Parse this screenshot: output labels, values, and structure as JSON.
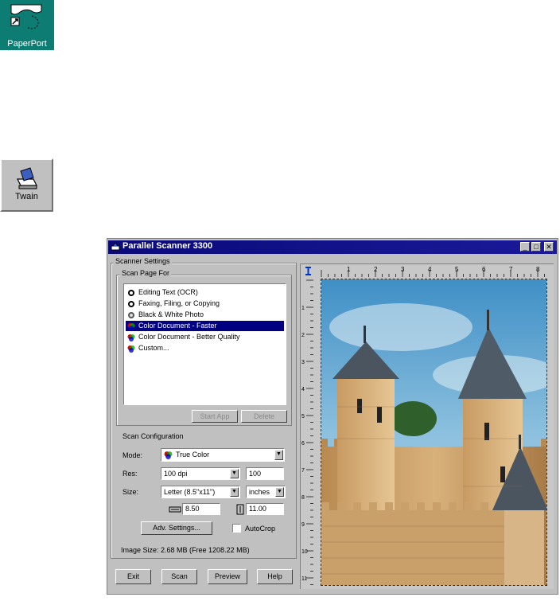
{
  "desktop": {
    "paperport_label": "PaperPort",
    "twain_label": "Twain"
  },
  "dialog": {
    "title": "Parallel Scanner 3300",
    "minimize": "_",
    "maximize": "□",
    "close": "✕",
    "scanner_settings_label": "Scanner Settings",
    "scan_page_for_label": "Scan Page For",
    "scan_options": [
      {
        "label": "Editing Text (OCR)",
        "icon": "bw-doc-icon"
      },
      {
        "label": "Faxing, Filing, or Copying",
        "icon": "bw-doc-icon"
      },
      {
        "label": "Black & White Photo",
        "icon": "bw-photo-icon"
      },
      {
        "label": "Color Document - Faster",
        "icon": "color-doc-icon",
        "selected": true
      },
      {
        "label": "Color Document - Better Quality",
        "icon": "color-doc-icon"
      },
      {
        "label": "Custom...",
        "icon": "color-doc-icon"
      }
    ],
    "start_app_button": "Start App",
    "delete_button": "Delete",
    "scan_config_label": "Scan Configuration",
    "mode_label": "Mode:",
    "mode_value": "True Color",
    "res_label": "Res:",
    "res_value": "100 dpi",
    "res_custom": "100",
    "size_label": "Size:",
    "size_value": "Letter (8.5\"x11\")",
    "units_value": "inches",
    "width_value": "8.50",
    "height_value": "11.00",
    "adv_settings_button": "Adv. Settings...",
    "autocrop_label": "AutoCrop",
    "autocrop_checked": false,
    "image_size_text": "Image Size: 2.68 MB (Free 1208.22 MB)",
    "buttons": {
      "exit": "Exit",
      "scan": "Scan",
      "preview": "Preview",
      "help": "Help"
    },
    "ruler_h_ticks": [
      "1",
      "2",
      "3",
      "4",
      "5",
      "6",
      "7",
      "8"
    ],
    "ruler_v_ticks": [
      "1",
      "2",
      "3",
      "4",
      "5",
      "6",
      "7",
      "8",
      "9",
      "10",
      "11"
    ],
    "colors": {
      "title_bar": "#0a0a7a",
      "selection": "#000080",
      "desktop_icon_bg": "#0d7d74",
      "face": "#c0c0c0"
    }
  }
}
